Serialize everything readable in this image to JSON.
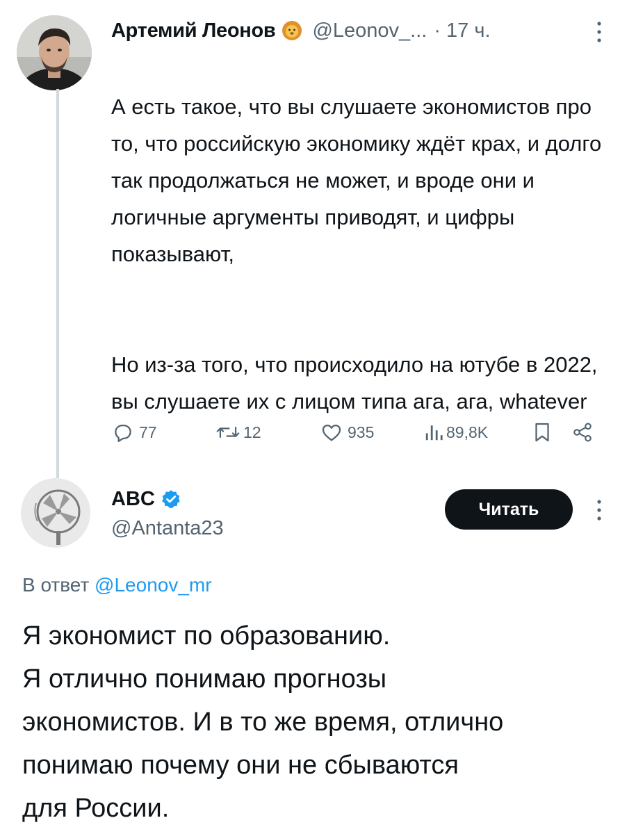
{
  "tweet": {
    "author_name": "Артемий Леонов",
    "author_handle": "@Leonov_...",
    "separator": "·",
    "time": "17 ч.",
    "text_para1": "А есть такое, что вы слушаете экономистов про то, что российскую экономику ждёт крах, и долго так продолжаться не может, и вроде они и логичные аргументы приводят, и цифры показывают,",
    "text_para2": "Но из-за того, что происходило на ютубе в 2022, вы слушаете их с лицом типа ага, ага, whatever",
    "actions": {
      "replies": "77",
      "reposts": "12",
      "likes": "935",
      "views": "89,8K"
    }
  },
  "reply": {
    "author_name": "ABC",
    "author_handle": "@Antanta23",
    "follow_label": "Читать",
    "reply_to_prefix": "В ответ",
    "reply_to_handle": "@Leonov_mr",
    "text_lines": [
      "Я экономист по образованию.",
      "Я отлично понимаю прогнозы",
      "экономистов. И в то же время, отлично",
      "понимаю почему они не сбываются",
      "для России."
    ]
  },
  "colors": {
    "text": "#0f1419",
    "muted": "#536471",
    "link": "#1d9bf0",
    "verified_blue": "#1d9bf0",
    "thread_line": "#cfd9de",
    "button_bg": "#0f1419"
  },
  "icons": {
    "author_badge": "lion-emoji-icon",
    "verified": "verified-badge-icon",
    "reply": "reply-bubble-icon",
    "repost": "repost-icon",
    "like": "heart-icon",
    "views": "views-bars-icon",
    "bookmark": "bookmark-icon",
    "share": "share-icon",
    "more": "more-vertical-icon"
  }
}
